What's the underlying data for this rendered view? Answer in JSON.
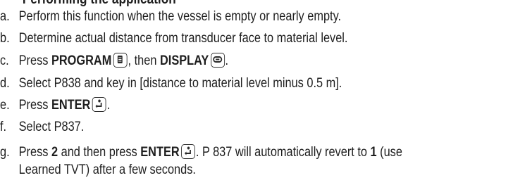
{
  "heading": "Performing the application",
  "steps": [
    {
      "marker": "a.",
      "text": "Perform this function when the vessel is empty or nearly empty."
    },
    {
      "marker": "b.",
      "text": "Determine actual distance from transducer face to material level."
    },
    {
      "marker": "c.",
      "pre": "Press ",
      "kw1": "PROGRAM",
      "mid": ", then ",
      "kw2": "DISPLAY",
      "post": "."
    },
    {
      "marker": "d.",
      "text": "Select P838 and key in [distance to material level minus 0.5 m]."
    },
    {
      "marker": "e.",
      "pre": "Press ",
      "kw1": "ENTER",
      "post": "."
    },
    {
      "marker": "f.",
      "text": "Select P837."
    },
    {
      "marker": "g.",
      "pre": "Press ",
      "num": "2",
      "mid": " and then press ",
      "kw1": "ENTER",
      "post1": ". P 837 will automatically revert to ",
      "num2": "1",
      "post2": " (use",
      "line2": "Learned TVT) after a few seconds."
    }
  ],
  "icons": {
    "program": "program-key-icon",
    "display": "display-key-icon",
    "enter": "enter-key-icon"
  }
}
